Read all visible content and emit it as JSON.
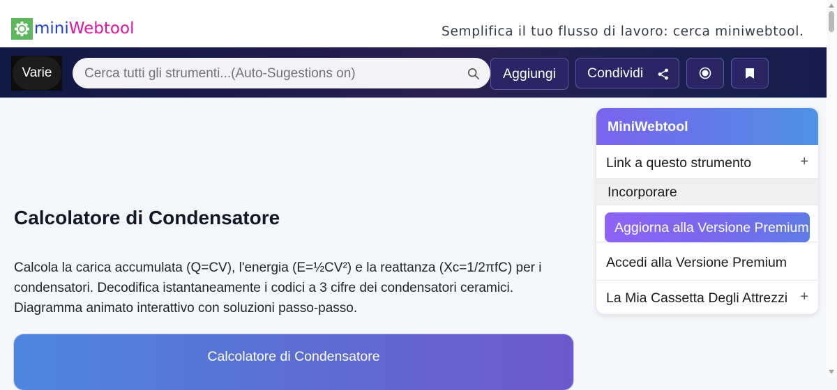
{
  "header": {
    "logo_part1": "mini",
    "logo_part2": "Webtool",
    "tagline": "Semplifica il tuo flusso di lavoro: cerca miniwebtool."
  },
  "navbar": {
    "category_label": "Varie",
    "search_placeholder": "Cerca tutti gli strumenti...(Auto-Sugestions on)",
    "add_label": "Aggiungi",
    "share_label": "Condividi"
  },
  "main": {
    "title": "Calcolatore di Condensatore",
    "description": "Calcola la carica accumulata (Q=CV), l'energia (E=½CV²) e la reattanza (Xc=1/2πfC) per i condensatori. Decodifica istantaneamente i codici a 3 cifre dei condensatori ceramici. Diagramma animato interattivo con soluzioni passo-passo.",
    "card_title": "Calcolatore di Condensatore"
  },
  "sidebar": {
    "title": "MiniWebtool",
    "link_label": "Link a questo strumento",
    "embed_label": "Incorporare",
    "premium_button": "Aggiorna alla Versione Premium",
    "login_premium": "Accedi alla Versione Premium",
    "toolbox_label": "La Mia Cassetta Degli Attrezzi",
    "plus_symbol": "+"
  },
  "colors": {
    "logo_green": "#5cb85c",
    "logo_blue": "#1f3fd1",
    "logo_pink": "#e0139f",
    "nav_bg": "#1e1a4a",
    "accent_purple": "#7a63ee"
  },
  "icons": {
    "logo": "gear-icon",
    "search": "search-icon",
    "share": "share-icon",
    "record": "record-icon",
    "bookmark": "bookmark-icon"
  }
}
